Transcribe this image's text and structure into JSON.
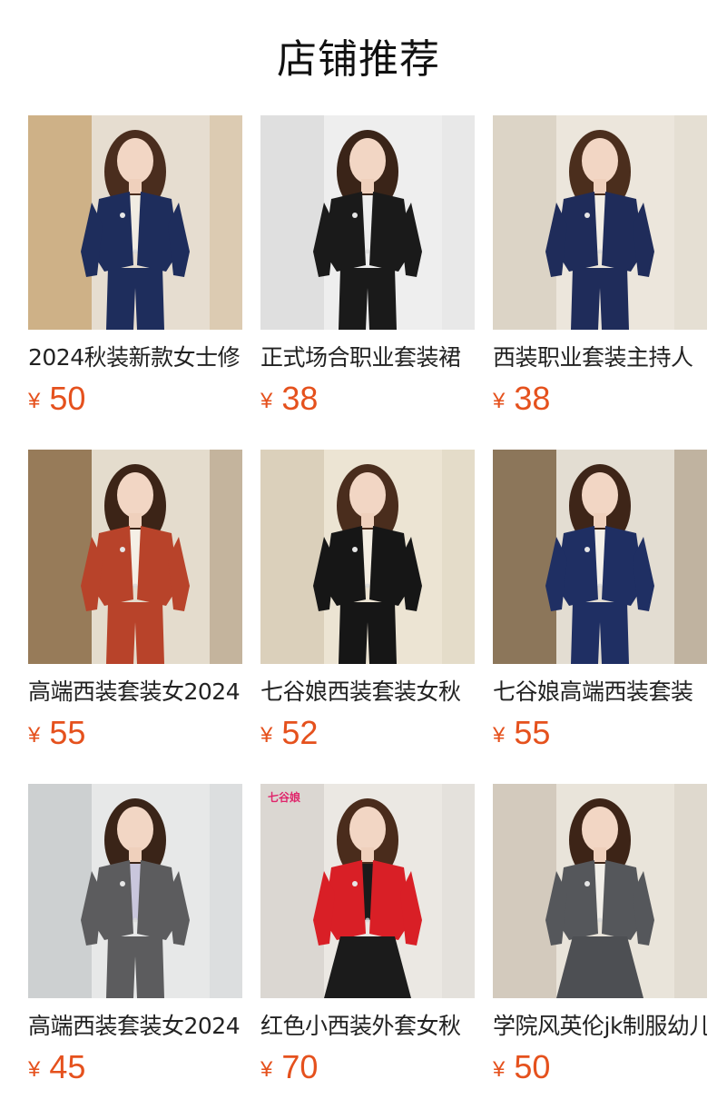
{
  "section": {
    "title": "店铺推荐"
  },
  "currency_symbol": "¥",
  "products": [
    {
      "title": "2024秋装新款女士修",
      "price": "50",
      "photo": "woman-navy-suit-photo",
      "colors": {
        "bg": "#c9a97a",
        "wall": "#e6ddd0",
        "jacket": "#1e2d5c",
        "inner": "#f1ece2",
        "bottom": "#1e2d5c",
        "hair": "#4a2d1e"
      }
    },
    {
      "title": "正式场合职业套装裙",
      "price": "38",
      "photo": "woman-black-suit-photo",
      "colors": {
        "bg": "#dcdcdc",
        "wall": "#eeeeee",
        "jacket": "#1a1a1a",
        "inner": "#eeeeee",
        "bottom": "#1a1a1a",
        "hair": "#3a2418"
      }
    },
    {
      "title": "西装职业套装主持人",
      "price": "38",
      "photo": "woman-navy-suit-photo",
      "colors": {
        "bg": "#d9d0c2",
        "wall": "#ece6dc",
        "jacket": "#1f2c5a",
        "inner": "#f2ede4",
        "bottom": "#1f2c5a",
        "hair": "#4b2e1d"
      }
    },
    {
      "title": "高端西装套装女2024",
      "price": "55",
      "photo": "woman-rust-red-suit-photo",
      "colors": {
        "bg": "#8a6a44",
        "wall": "#e4dccd",
        "jacket": "#b8432a",
        "inner": "#f4efe6",
        "bottom": "#b8432a",
        "hair": "#3c2417"
      }
    },
    {
      "title": "七谷娘西装套装女秋",
      "price": "52",
      "photo": "woman-black-suit-photo",
      "colors": {
        "bg": "#d8cdb6",
        "wall": "#ece4d3",
        "jacket": "#161616",
        "inner": "#f3ede2",
        "bottom": "#161616",
        "hair": "#4a2d1d"
      }
    },
    {
      "title": "七谷娘高端西装套装",
      "price": "55",
      "photo": "woman-navy-suit-photo",
      "colors": {
        "bg": "#7d6445",
        "wall": "#e3ddd2",
        "jacket": "#1f2f63",
        "inner": "#f4f0e8",
        "bottom": "#1f2f63",
        "hair": "#3e2518"
      }
    },
    {
      "title": "高端西装套装女2024",
      "price": "45",
      "photo": "woman-gray-suit-photo",
      "colors": {
        "bg": "#c8cbcd",
        "wall": "#e7e8e8",
        "jacket": "#5c5c5e",
        "inner": "#c9c6dc",
        "bottom": "#5c5c5e",
        "hair": "#3a2418"
      }
    },
    {
      "title": "红色小西装外套女秋",
      "price": "70",
      "photo": "woman-red-jacket-photo",
      "brand_mark": "七谷娘",
      "colors": {
        "bg": "#d8d4cf",
        "wall": "#ebe8e3",
        "jacket": "#d91f26",
        "inner": "#1a1a1a",
        "bottom": "#1b1b1b",
        "hair": "#4a2c1c"
      }
    },
    {
      "title": "学院风英伦jk制服幼儿",
      "price": "50",
      "photo": "woman-gray-suit-photo",
      "colors": {
        "bg": "#cfc6b7",
        "wall": "#e9e4da",
        "jacket": "#55575b",
        "inner": "#f1eee8",
        "bottom": "#4d4f53",
        "hair": "#3d2417"
      }
    }
  ]
}
